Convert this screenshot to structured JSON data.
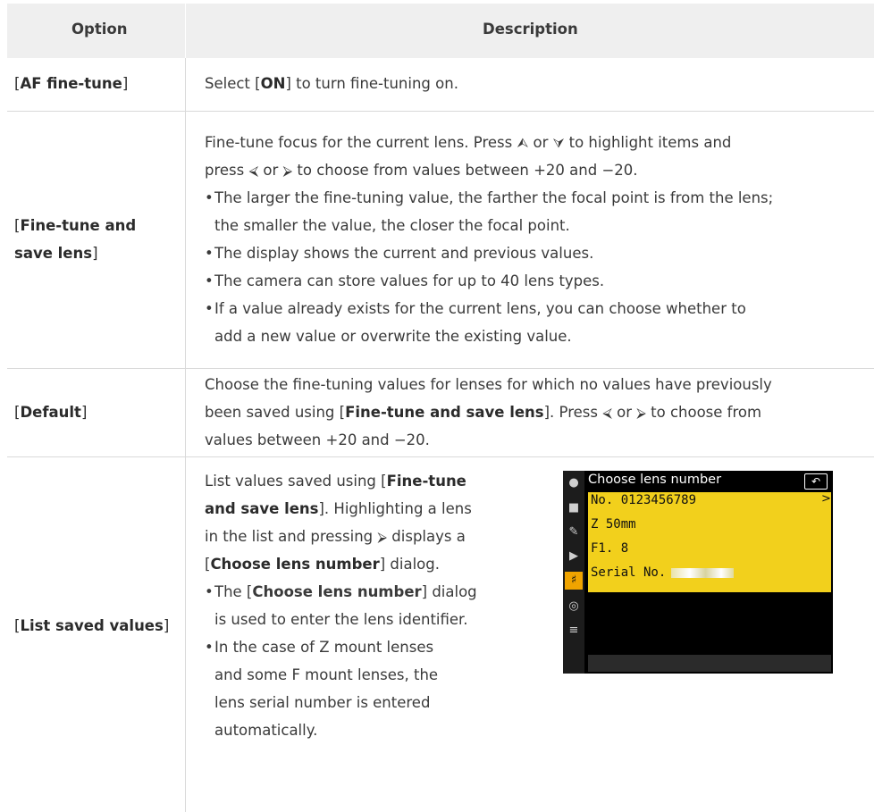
{
  "table": {
    "col_option": "Option",
    "col_description": "Description",
    "rows": [
      {
        "option_pre": "[",
        "option_bold": "AF fine-tune",
        "option_post": "]",
        "desc_pre": "Select [",
        "desc_bold": "ON",
        "desc_post": "] to turn fine-tuning on."
      },
      {
        "option_pre": "[",
        "option_bold_1": "Fine-tune and",
        "option_bold_2": "save lens",
        "option_post": "]",
        "desc_line1": "Fine-tune focus for the current lens. Press ",
        "desc_line1_mid": " or ",
        "desc_line1_end": " to highlight items and",
        "desc_line2_pre": "press ",
        "desc_line2_mid": " or ",
        "desc_line2_end": " to choose from values between +20 and −20.",
        "bullets": [
          [
            "The larger the fine-tuning value, the farther the focal point is from the lens;",
            "the smaller the value, the closer the focal point."
          ],
          [
            "The display shows the current and previous values."
          ],
          [
            "The camera can store values for up to 40 lens types."
          ],
          [
            "If a value already exists for the current lens, you can choose whether to",
            "add a new value or overwrite the existing value."
          ]
        ]
      },
      {
        "option_pre": "[",
        "option_bold": "Default",
        "option_post": "]",
        "desc_line1": "Choose the fine-tuning values for lenses for which no values have previously",
        "desc_line2_pre": "been saved using [",
        "desc_line2_bold": "Fine-tune and save lens",
        "desc_line2_post": "]. Press ",
        "desc_line2_mid": " or ",
        "desc_line2_end": " to choose from",
        "desc_line3": "values between +20 and −20."
      },
      {
        "option_pre": "[",
        "option_bold": "List saved values",
        "option_post": "]",
        "desc_line1_pre": "List values saved using [",
        "desc_line1_bold": "Fine-tune",
        "desc_line2_bold": "and save lens",
        "desc_line2_post": "]. Highlighting a lens",
        "desc_line3_pre": "in the list and pressing ",
        "desc_line3_post": " displays a",
        "desc_line4_pre": "[",
        "desc_line4_bold": "Choose lens number",
        "desc_line4_post": "] dialog.",
        "bullet1_l1_pre": "The [",
        "bullet1_l1_bold": "Choose lens number",
        "bullet1_l1_post": "] dialog",
        "bullet1_l2": "is used to enter the lens identifier.",
        "bullet2": [
          "In the case of Z mount lenses",
          "and some F mount lenses, the",
          "lens serial number is entered",
          "automatically."
        ]
      }
    ]
  },
  "glyphs": {
    "up": "⮙",
    "down": "⮛",
    "left": "⮘",
    "right": "⮚",
    "bullet": "•"
  },
  "screen": {
    "title": "Choose lens number",
    "back_glyph": "↶",
    "lines": [
      "No. 0123456789",
      "Z 50mm",
      "F1. 8",
      "Serial No."
    ],
    "arrow": ">",
    "side_icons": [
      "camera-icon",
      "movie-icon",
      "pencil-icon",
      "playback-icon",
      "wrench-icon",
      "network-icon",
      "my-menu-icon"
    ],
    "accent": "#f2d01c"
  }
}
